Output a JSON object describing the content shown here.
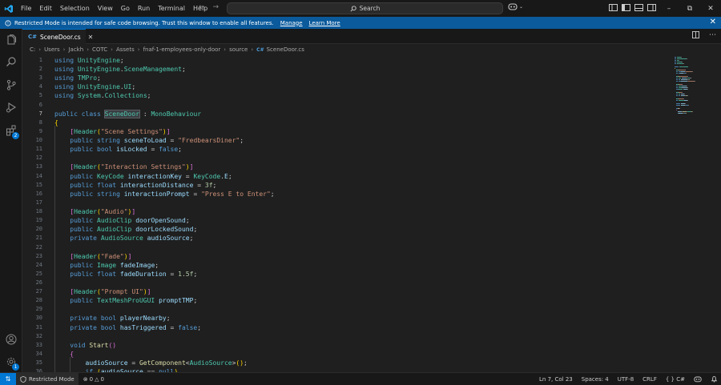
{
  "menu": [
    "File",
    "Edit",
    "Selection",
    "View",
    "Go",
    "Run",
    "Terminal",
    "Help"
  ],
  "search": {
    "label": "Search"
  },
  "banner": {
    "message": "Restricted Mode is intended for safe code browsing. Trust this window to enable all features.",
    "manage_link": "Manage",
    "learn_link": "Learn More"
  },
  "activity": {
    "extensions_badge": "2",
    "manage_badge": "1"
  },
  "tab": {
    "icon_text": "C#",
    "filename": "SceneDoor.cs"
  },
  "breadcrumb": [
    "C:",
    "Users",
    "Jackh",
    "COTC",
    "Assets",
    "fnaf-1-employees-only-door",
    "source",
    "SceneDoor.cs"
  ],
  "editor": {
    "active_line": 7,
    "lines": [
      {
        "n": "1",
        "t": [
          [
            "kw",
            "using"
          ],
          [
            "pl",
            " "
          ],
          [
            "ty",
            "UnityEngine"
          ],
          [
            "pl",
            ";"
          ]
        ]
      },
      {
        "n": "2",
        "t": [
          [
            "kw",
            "using"
          ],
          [
            "pl",
            " "
          ],
          [
            "ty",
            "UnityEngine"
          ],
          [
            "pl",
            "."
          ],
          [
            "ty",
            "SceneManagement"
          ],
          [
            "pl",
            ";"
          ]
        ]
      },
      {
        "n": "3",
        "t": [
          [
            "kw",
            "using"
          ],
          [
            "pl",
            " "
          ],
          [
            "ty",
            "TMPro"
          ],
          [
            "pl",
            ";"
          ]
        ]
      },
      {
        "n": "4",
        "t": [
          [
            "kw",
            "using"
          ],
          [
            "pl",
            " "
          ],
          [
            "ty",
            "UnityEngine"
          ],
          [
            "pl",
            "."
          ],
          [
            "ty",
            "UI"
          ],
          [
            "pl",
            ";"
          ]
        ]
      },
      {
        "n": "5",
        "t": [
          [
            "kw",
            "using"
          ],
          [
            "pl",
            " "
          ],
          [
            "ty",
            "System"
          ],
          [
            "pl",
            "."
          ],
          [
            "ty",
            "Collections"
          ],
          [
            "pl",
            ";"
          ]
        ]
      },
      {
        "n": "6",
        "t": []
      },
      {
        "n": "7",
        "t": [
          [
            "kw",
            "public"
          ],
          [
            "pl",
            " "
          ],
          [
            "kw",
            "class"
          ],
          [
            "pl",
            " "
          ],
          [
            "tyhl",
            "SceneDoor"
          ],
          [
            "pl",
            " : "
          ],
          [
            "ty",
            "MonoBehaviour"
          ]
        ]
      },
      {
        "n": "8",
        "t": [
          [
            "br1",
            "{"
          ]
        ]
      },
      {
        "n": "9",
        "t": [
          [
            "pl",
            "    "
          ],
          [
            "br2",
            "["
          ],
          [
            "ty",
            "Header"
          ],
          [
            "br1",
            "("
          ],
          [
            "str",
            "\"Scene Settings\""
          ],
          [
            "br1",
            ")"
          ],
          [
            "br2",
            "]"
          ]
        ]
      },
      {
        "n": "10",
        "t": [
          [
            "pl",
            "    "
          ],
          [
            "kw",
            "public"
          ],
          [
            "pl",
            " "
          ],
          [
            "kw",
            "string"
          ],
          [
            "pl",
            " "
          ],
          [
            "var",
            "sceneToLoad"
          ],
          [
            "pl",
            " = "
          ],
          [
            "str",
            "\"FredbearsDiner\""
          ],
          [
            "pl",
            ";"
          ]
        ]
      },
      {
        "n": "11",
        "t": [
          [
            "pl",
            "    "
          ],
          [
            "kw",
            "public"
          ],
          [
            "pl",
            " "
          ],
          [
            "kw",
            "bool"
          ],
          [
            "pl",
            " "
          ],
          [
            "var",
            "isLocked"
          ],
          [
            "pl",
            " = "
          ],
          [
            "kw",
            "false"
          ],
          [
            "pl",
            ";"
          ]
        ]
      },
      {
        "n": "12",
        "t": []
      },
      {
        "n": "13",
        "t": [
          [
            "pl",
            "    "
          ],
          [
            "br2",
            "["
          ],
          [
            "ty",
            "Header"
          ],
          [
            "br1",
            "("
          ],
          [
            "str",
            "\"Interaction Settings\""
          ],
          [
            "br1",
            ")"
          ],
          [
            "br2",
            "]"
          ]
        ]
      },
      {
        "n": "14",
        "t": [
          [
            "pl",
            "    "
          ],
          [
            "kw",
            "public"
          ],
          [
            "pl",
            " "
          ],
          [
            "ty",
            "KeyCode"
          ],
          [
            "pl",
            " "
          ],
          [
            "var",
            "interactionKey"
          ],
          [
            "pl",
            " = "
          ],
          [
            "ty",
            "KeyCode"
          ],
          [
            "pl",
            "."
          ],
          [
            "var",
            "E"
          ],
          [
            "pl",
            ";"
          ]
        ]
      },
      {
        "n": "15",
        "t": [
          [
            "pl",
            "    "
          ],
          [
            "kw",
            "public"
          ],
          [
            "pl",
            " "
          ],
          [
            "kw",
            "float"
          ],
          [
            "pl",
            " "
          ],
          [
            "var",
            "interactionDistance"
          ],
          [
            "pl",
            " = "
          ],
          [
            "num",
            "3f"
          ],
          [
            "pl",
            ";"
          ]
        ]
      },
      {
        "n": "16",
        "t": [
          [
            "pl",
            "    "
          ],
          [
            "kw",
            "public"
          ],
          [
            "pl",
            " "
          ],
          [
            "kw",
            "string"
          ],
          [
            "pl",
            " "
          ],
          [
            "var",
            "interactionPrompt"
          ],
          [
            "pl",
            " = "
          ],
          [
            "str",
            "\"Press E to Enter\""
          ],
          [
            "pl",
            ";"
          ]
        ]
      },
      {
        "n": "17",
        "t": []
      },
      {
        "n": "18",
        "t": [
          [
            "pl",
            "    "
          ],
          [
            "br2",
            "["
          ],
          [
            "ty",
            "Header"
          ],
          [
            "br1",
            "("
          ],
          [
            "str",
            "\"Audio\""
          ],
          [
            "br1",
            ")"
          ],
          [
            "br2",
            "]"
          ]
        ]
      },
      {
        "n": "19",
        "t": [
          [
            "pl",
            "    "
          ],
          [
            "kw",
            "public"
          ],
          [
            "pl",
            " "
          ],
          [
            "ty",
            "AudioClip"
          ],
          [
            "pl",
            " "
          ],
          [
            "var",
            "doorOpenSound"
          ],
          [
            "pl",
            ";"
          ]
        ]
      },
      {
        "n": "20",
        "t": [
          [
            "pl",
            "    "
          ],
          [
            "kw",
            "public"
          ],
          [
            "pl",
            " "
          ],
          [
            "ty",
            "AudioClip"
          ],
          [
            "pl",
            " "
          ],
          [
            "var",
            "doorLockedSound"
          ],
          [
            "pl",
            ";"
          ]
        ]
      },
      {
        "n": "21",
        "t": [
          [
            "pl",
            "    "
          ],
          [
            "kw",
            "private"
          ],
          [
            "pl",
            " "
          ],
          [
            "ty",
            "AudioSource"
          ],
          [
            "pl",
            " "
          ],
          [
            "var",
            "audioSource"
          ],
          [
            "pl",
            ";"
          ]
        ]
      },
      {
        "n": "22",
        "t": []
      },
      {
        "n": "23",
        "t": [
          [
            "pl",
            "    "
          ],
          [
            "br2",
            "["
          ],
          [
            "ty",
            "Header"
          ],
          [
            "br1",
            "("
          ],
          [
            "str",
            "\"Fade\""
          ],
          [
            "br1",
            ")"
          ],
          [
            "br2",
            "]"
          ]
        ]
      },
      {
        "n": "24",
        "t": [
          [
            "pl",
            "    "
          ],
          [
            "kw",
            "public"
          ],
          [
            "pl",
            " "
          ],
          [
            "ty",
            "Image"
          ],
          [
            "pl",
            " "
          ],
          [
            "var",
            "fadeImage"
          ],
          [
            "pl",
            ";"
          ]
        ]
      },
      {
        "n": "25",
        "t": [
          [
            "pl",
            "    "
          ],
          [
            "kw",
            "public"
          ],
          [
            "pl",
            " "
          ],
          [
            "kw",
            "float"
          ],
          [
            "pl",
            " "
          ],
          [
            "var",
            "fadeDuration"
          ],
          [
            "pl",
            " = "
          ],
          [
            "num",
            "1.5f"
          ],
          [
            "pl",
            ";"
          ]
        ]
      },
      {
        "n": "26",
        "t": []
      },
      {
        "n": "27",
        "t": [
          [
            "pl",
            "    "
          ],
          [
            "br2",
            "["
          ],
          [
            "ty",
            "Header"
          ],
          [
            "br1",
            "("
          ],
          [
            "str",
            "\"Prompt UI\""
          ],
          [
            "br1",
            ")"
          ],
          [
            "br2",
            "]"
          ]
        ]
      },
      {
        "n": "28",
        "t": [
          [
            "pl",
            "    "
          ],
          [
            "kw",
            "public"
          ],
          [
            "pl",
            " "
          ],
          [
            "ty",
            "TextMeshProUGUI"
          ],
          [
            "pl",
            " "
          ],
          [
            "var",
            "promptTMP"
          ],
          [
            "pl",
            ";"
          ]
        ]
      },
      {
        "n": "29",
        "t": []
      },
      {
        "n": "30",
        "t": [
          [
            "pl",
            "    "
          ],
          [
            "kw",
            "private"
          ],
          [
            "pl",
            " "
          ],
          [
            "kw",
            "bool"
          ],
          [
            "pl",
            " "
          ],
          [
            "var",
            "playerNearby"
          ],
          [
            "pl",
            ";"
          ]
        ]
      },
      {
        "n": "31",
        "t": [
          [
            "pl",
            "    "
          ],
          [
            "kw",
            "private"
          ],
          [
            "pl",
            " "
          ],
          [
            "kw",
            "bool"
          ],
          [
            "pl",
            " "
          ],
          [
            "var",
            "hasTriggered"
          ],
          [
            "pl",
            " = "
          ],
          [
            "kw",
            "false"
          ],
          [
            "pl",
            ";"
          ]
        ]
      },
      {
        "n": "32",
        "t": []
      },
      {
        "n": "33",
        "t": [
          [
            "pl",
            "    "
          ],
          [
            "kw",
            "void"
          ],
          [
            "pl",
            " "
          ],
          [
            "fn",
            "Start"
          ],
          [
            "br2",
            "()"
          ]
        ]
      },
      {
        "n": "34",
        "t": [
          [
            "pl",
            "    "
          ],
          [
            "br2",
            "{"
          ]
        ]
      },
      {
        "n": "35",
        "t": [
          [
            "pl",
            "        "
          ],
          [
            "var",
            "audioSource"
          ],
          [
            "pl",
            " = "
          ],
          [
            "fn",
            "GetComponent"
          ],
          [
            "pl",
            "<"
          ],
          [
            "ty",
            "AudioSource"
          ],
          [
            "pl",
            ">"
          ],
          [
            "br1",
            "()"
          ],
          [
            "pl",
            ";"
          ]
        ]
      },
      {
        "n": "36",
        "t": [
          [
            "pl",
            "        "
          ],
          [
            "kw",
            "if"
          ],
          [
            "pl",
            " "
          ],
          [
            "br1",
            "("
          ],
          [
            "var",
            "audioSource"
          ],
          [
            "pl",
            " == "
          ],
          [
            "kw",
            "null"
          ],
          [
            "br1",
            ")"
          ]
        ]
      }
    ]
  },
  "status": {
    "restricted": "Restricted Mode",
    "errors": "0",
    "warnings": "0",
    "position": "Ln 7, Col 23",
    "spaces": "Spaces: 4",
    "encoding": "UTF-8",
    "eol": "CRLF",
    "language": "C#"
  },
  "colors": {
    "accent": "#0078d4",
    "banner": "#0a5a9c",
    "keyword": "#569cd6",
    "type": "#4ec9b0",
    "string": "#ce9178",
    "number": "#b5cea8",
    "variable": "#9cdcfe",
    "function": "#dcdcaa"
  }
}
